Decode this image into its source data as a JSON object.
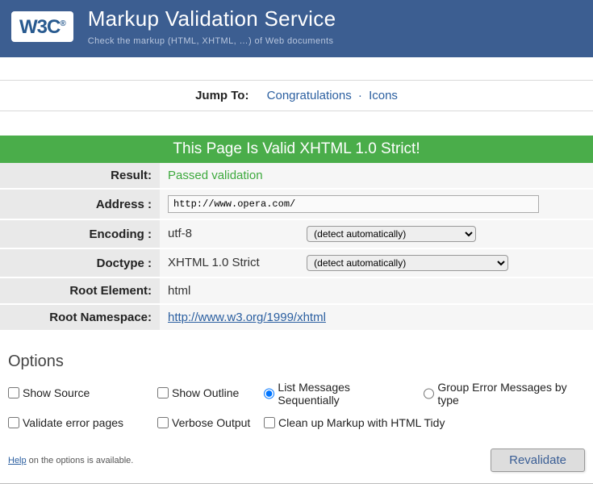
{
  "header": {
    "logo": "W3C",
    "logo_reg": "®",
    "title": "Markup Validation Service",
    "subtitle": "Check the markup (HTML, XHTML, …) of Web documents"
  },
  "jumpto": {
    "label": "Jump To:",
    "link1": "Congratulations",
    "sep": "·",
    "link2": "Icons"
  },
  "banner": "This Page Is Valid XHTML 1.0 Strict!",
  "rows": {
    "result_label": "Result:",
    "result_value": "Passed validation",
    "address_label": "Address :",
    "address_value": "http://www.opera.com/",
    "encoding_label": "Encoding :",
    "encoding_value": "utf-8",
    "encoding_select": "(detect automatically)",
    "doctype_label": "Doctype :",
    "doctype_value": "XHTML 1.0 Strict",
    "doctype_select": "(detect automatically)",
    "root_element_label": "Root Element:",
    "root_element_value": "html",
    "root_ns_label": "Root Namespace:",
    "root_ns_value": "http://www.w3.org/1999/xhtml"
  },
  "options": {
    "title": "Options",
    "show_source": "Show Source",
    "show_outline": "Show Outline",
    "list_sequential": "List Messages Sequentially",
    "group_errors": "Group Error Messages by type",
    "validate_error_pages": "Validate error pages",
    "verbose_output": "Verbose Output",
    "clean_tidy": "Clean up Markup with HTML Tidy",
    "help_pre": "Help",
    "help_post": " on the options is available.",
    "revalidate": "Revalidate"
  }
}
